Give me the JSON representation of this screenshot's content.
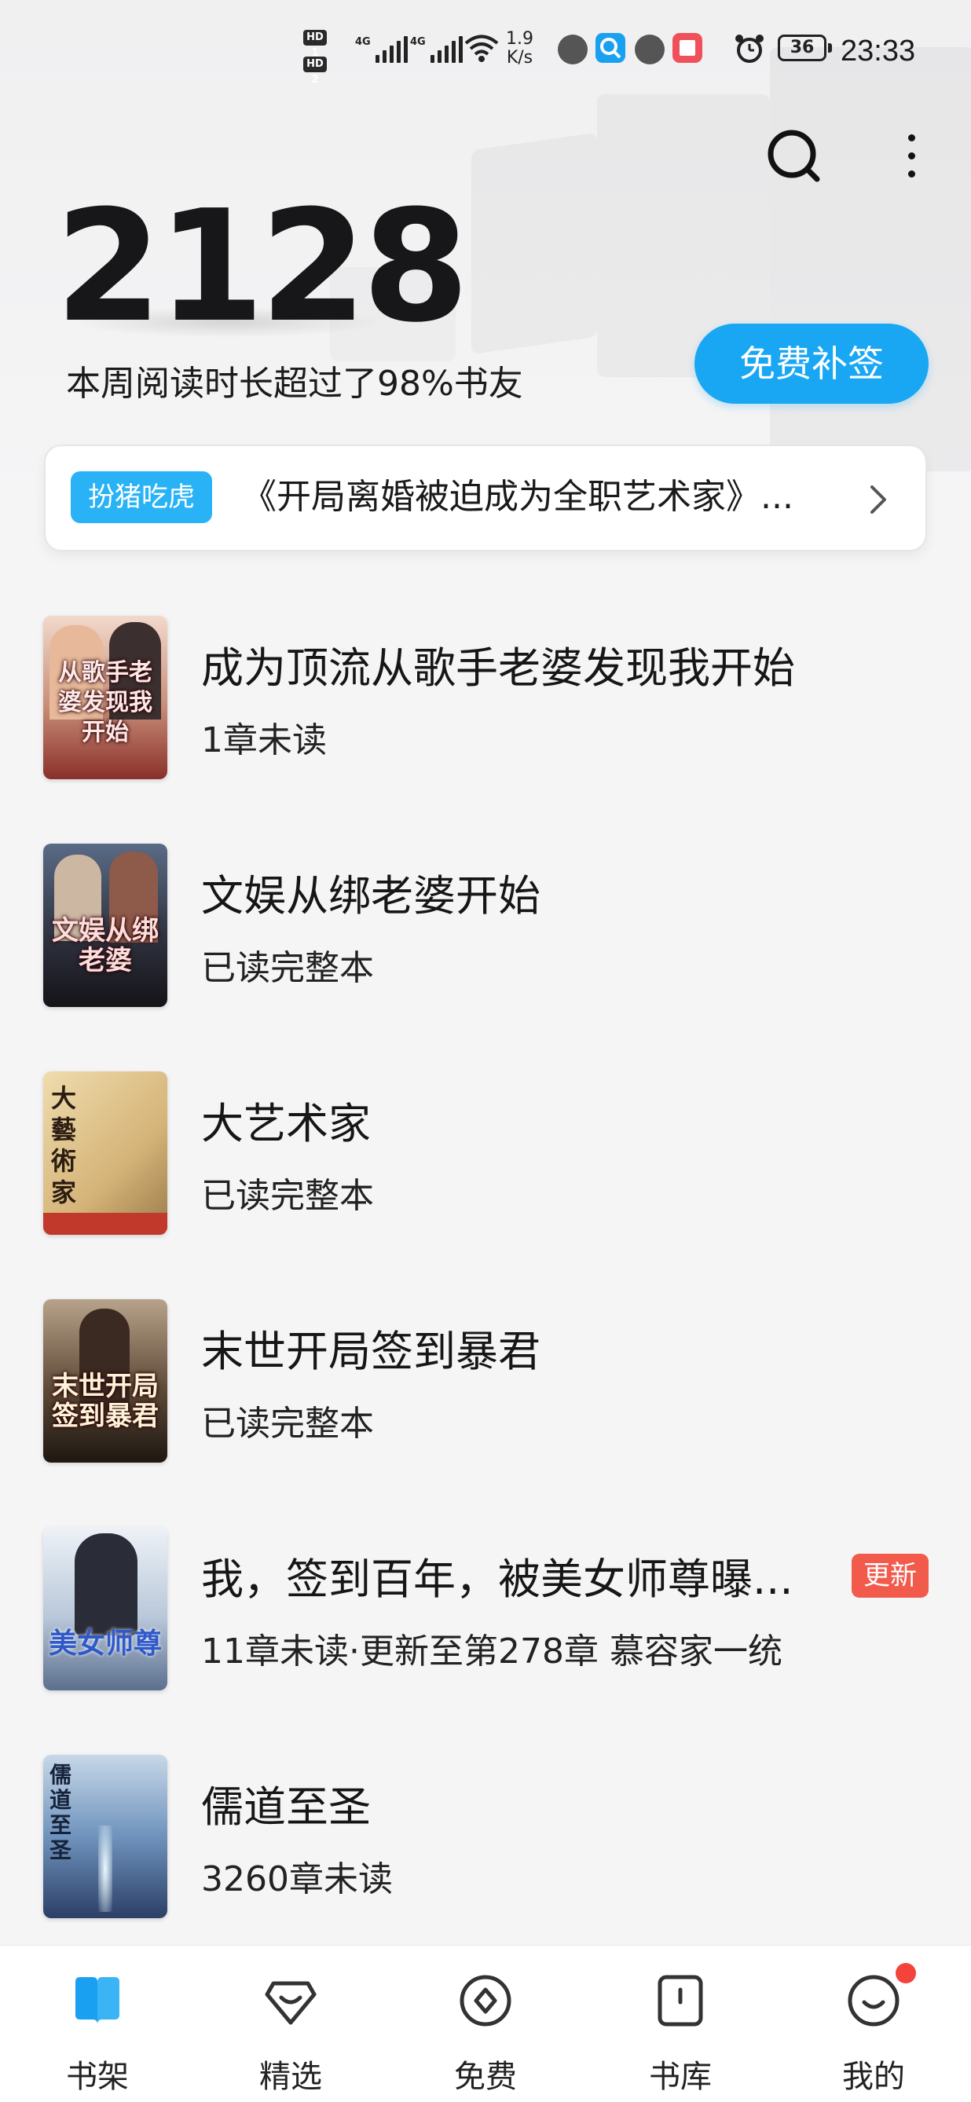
{
  "status_bar": {
    "hd1": "HD 1",
    "hd2": "HD 2",
    "net1": "4G",
    "net2": "4G",
    "speed_value": "1.9",
    "speed_unit": "K/s",
    "battery": "36",
    "time": "23:33"
  },
  "header": {
    "reading_count": "2128",
    "week_text": "本周阅读时长超过了98%书友",
    "signin_button": "免费补签"
  },
  "recommendation": {
    "tag": "扮猪吃虎",
    "title": "《开局离婚被迫成为全职艺术家》..."
  },
  "books": [
    {
      "title": "成为顶流从歌手老婆发现我开始",
      "status": "1章未读",
      "cover_text": "从歌手老婆发现我开始",
      "cover_color": "#c8a08a"
    },
    {
      "title": "文娱从绑老婆开始",
      "status": "已读完整本",
      "cover_text": "文娱从绑老婆",
      "cover_color": "#3b3f52"
    },
    {
      "title": "大艺术家",
      "status": "已读完整本",
      "cover_text": "大藝術家",
      "cover_color": "#d8c08a"
    },
    {
      "title": "末世开局签到暴君",
      "status": "已读完整本",
      "cover_text": "末世开局签到暴君",
      "cover_color": "#6b5a44"
    },
    {
      "title": "我，签到百年，被美女师尊曝...",
      "status": "11章未读·更新至第278章 慕容家一统",
      "cover_text": "美女师尊",
      "cover_color": "#c9d6e4",
      "badge": "更新"
    },
    {
      "title": "儒道至圣",
      "status": "3260章未读",
      "cover_text": "儒道至圣",
      "cover_color": "#7fa2c6"
    }
  ],
  "bottom_nav": [
    {
      "label": "书架",
      "icon": "bookshelf-icon",
      "active": true
    },
    {
      "label": "精选",
      "icon": "featured-icon",
      "active": false
    },
    {
      "label": "免费",
      "icon": "free-icon",
      "active": false
    },
    {
      "label": "书库",
      "icon": "library-icon",
      "active": false
    },
    {
      "label": "我的",
      "icon": "profile-icon",
      "active": false,
      "dot": true
    }
  ],
  "colors": {
    "accent": "#19a7f3",
    "badge_red": "#f25a4c"
  }
}
